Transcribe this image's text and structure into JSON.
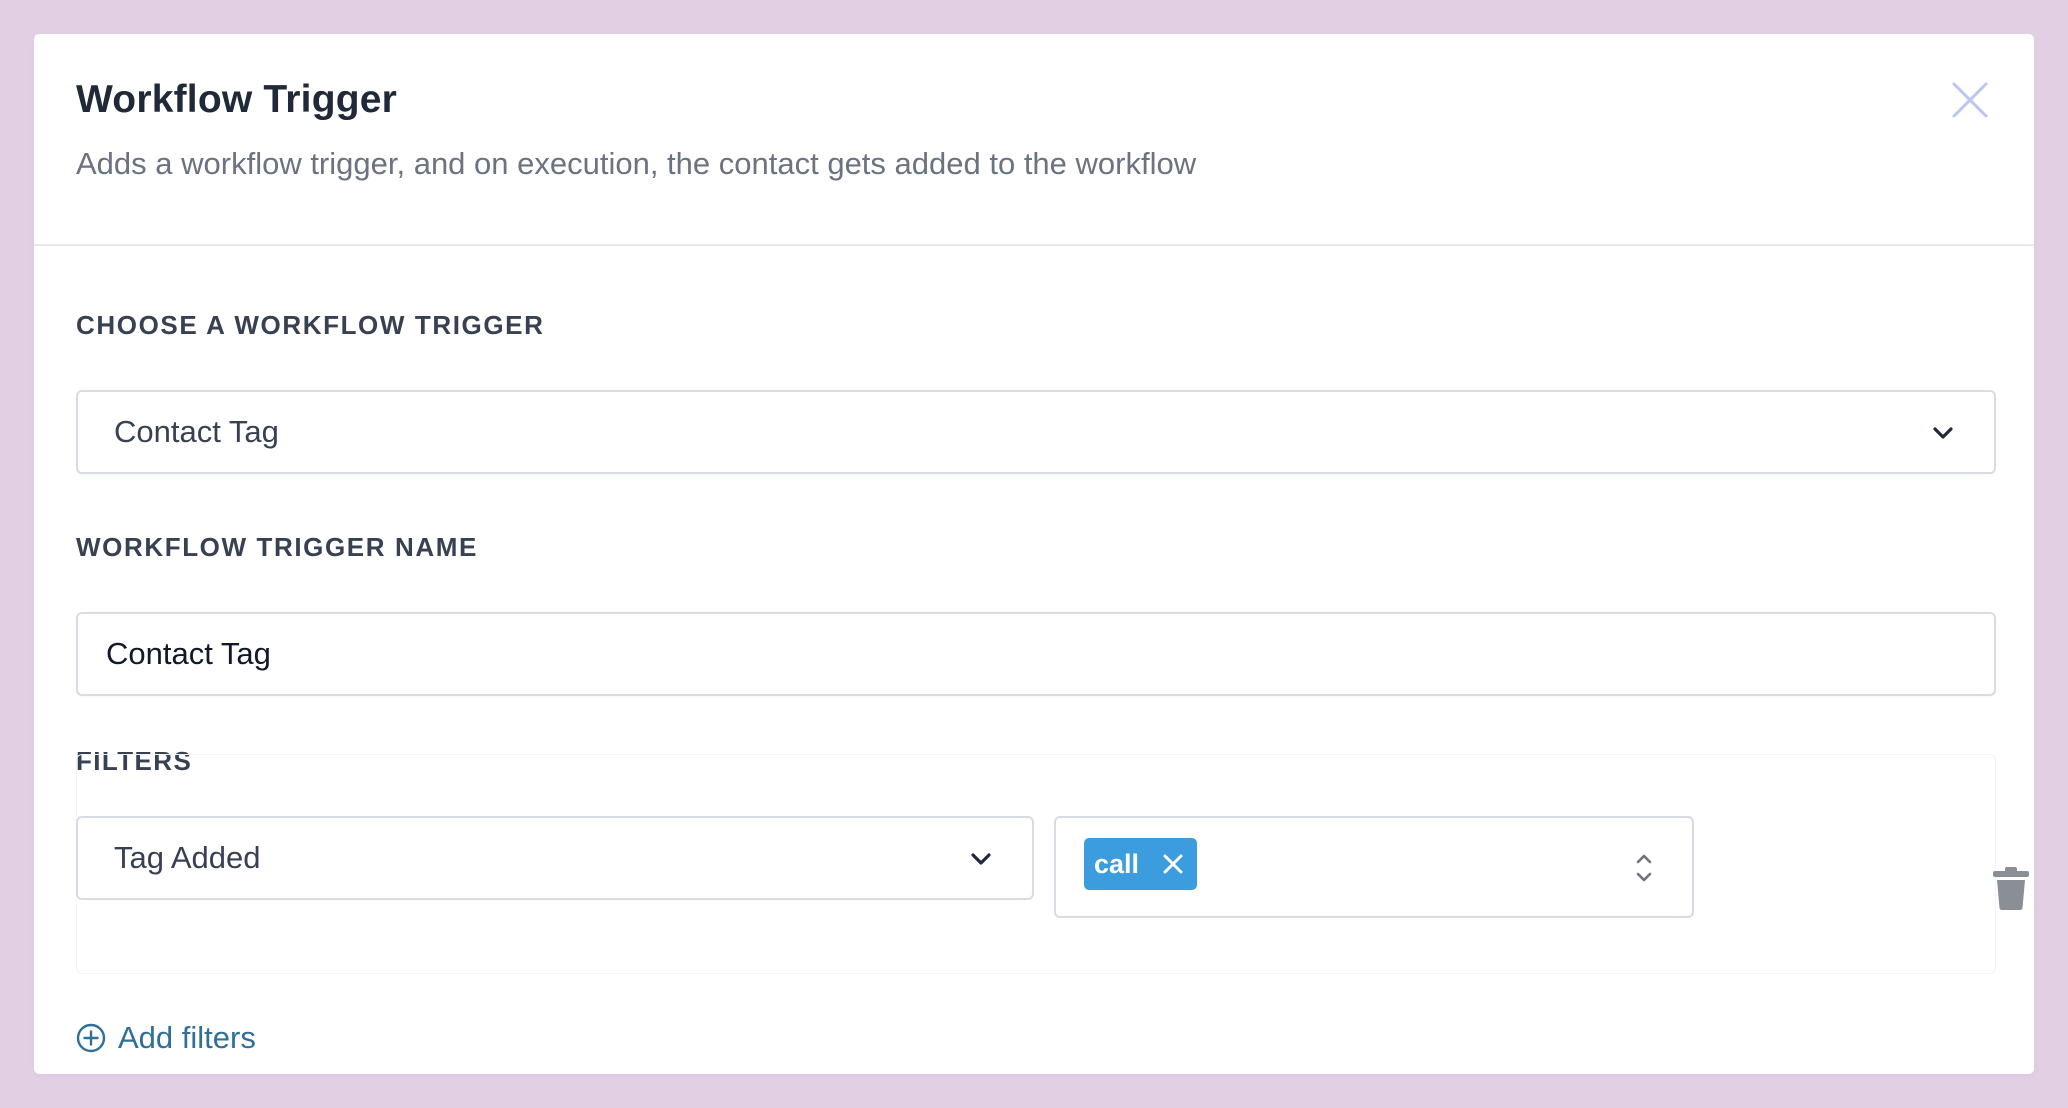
{
  "modal": {
    "title": "Workflow Trigger",
    "subtitle": "Adds a workflow trigger, and on execution, the contact gets added to the workflow",
    "close_icon": "close-icon"
  },
  "trigger_select": {
    "label": "CHOOSE A WORKFLOW TRIGGER",
    "value": "Contact Tag",
    "icon": "chevron-down-icon"
  },
  "trigger_name": {
    "label": "WORKFLOW TRIGGER NAME",
    "value": "Contact Tag"
  },
  "filters": {
    "label": "FILTERS",
    "items": [
      {
        "condition": "Tag Added",
        "tags": [
          "call"
        ]
      }
    ],
    "add_label": "Add filters"
  },
  "colors": {
    "background": "#e2cfe4",
    "tag_chip": "#3b9ddd",
    "link": "#2f6f99",
    "close_icon": "#b9c6f2"
  }
}
